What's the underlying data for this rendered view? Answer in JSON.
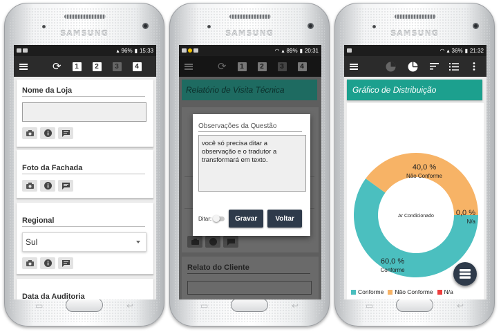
{
  "phone_brand": "SAMSUNG",
  "screen1": {
    "status": {
      "battery": "96%",
      "time": "15:33"
    },
    "toolbar": {
      "steps": [
        "1",
        "2",
        "3",
        "4"
      ]
    },
    "cards": {
      "store_name": {
        "label": "Nome da Loja",
        "value": ""
      },
      "facade_photo": {
        "label": "Foto da Fachada"
      },
      "region": {
        "label": "Regional",
        "selected": "Sul"
      },
      "audit_date": {
        "label": "Data da Auditoria"
      }
    }
  },
  "screen2": {
    "status": {
      "battery": "89%",
      "time": "20:31"
    },
    "report_title": "Relatório de Visita Técnica",
    "dialog": {
      "title": "Observações da Questão",
      "text": "você só precisa ditar a observação e o tradutor a transformará em texto.",
      "dictate_label": "Ditar:",
      "record_button": "Gravar",
      "back_button": "Voltar"
    },
    "client_section": "Relato do Cliente"
  },
  "screen3": {
    "status": {
      "battery": "36%",
      "time": "21:32"
    },
    "chart_title": "Gráfico de Distribuição",
    "center_label": "Ar Condicionado",
    "colors": {
      "conforme": "#4bbfbf",
      "nao_conforme": "#f7b366",
      "na": "#ee3e3e"
    },
    "chart_data": {
      "type": "pie",
      "title": "Gráfico de Distribuição",
      "donut": true,
      "slices": [
        {
          "name": "Conforme",
          "value": 60.0,
          "label": "60,0 %"
        },
        {
          "name": "Não Conforme",
          "value": 40.0,
          "label": "40,0 %"
        },
        {
          "name": "N/a",
          "value": 0.0,
          "label": "0,0 %"
        }
      ],
      "legend": [
        "Conforme",
        "Não Conforme",
        "N/a"
      ],
      "legend_position": "bottom-left"
    }
  }
}
